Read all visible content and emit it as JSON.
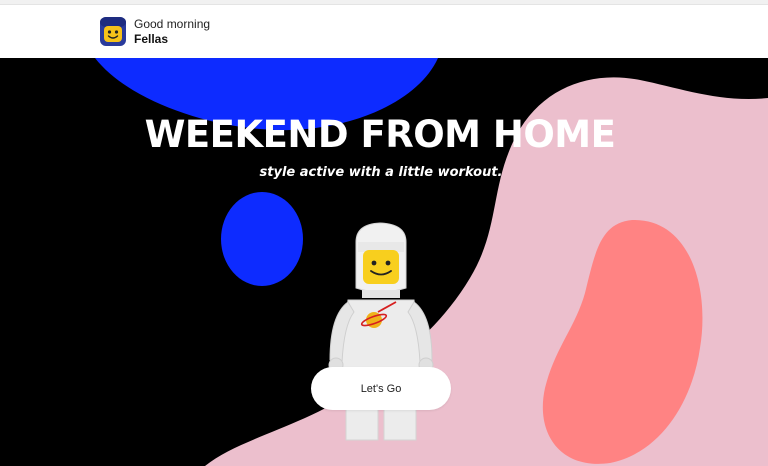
{
  "header": {
    "greeting": "Good morning",
    "user_name": "Fellas",
    "avatar_icon": "lego-minifig-face-icon"
  },
  "hero": {
    "title": "WEEKEND FROM HOME",
    "subtitle": "style active with a little workout.",
    "cta_label": "Let's Go",
    "figure_icon": "lego-astronaut-icon"
  },
  "colors": {
    "background": "#000000",
    "pink_blob": "#ecbfcd",
    "coral_blob": "#ff8383",
    "blue_blob": "#0d2bff",
    "button_bg": "#ffffff",
    "text_light": "#ffffff"
  }
}
